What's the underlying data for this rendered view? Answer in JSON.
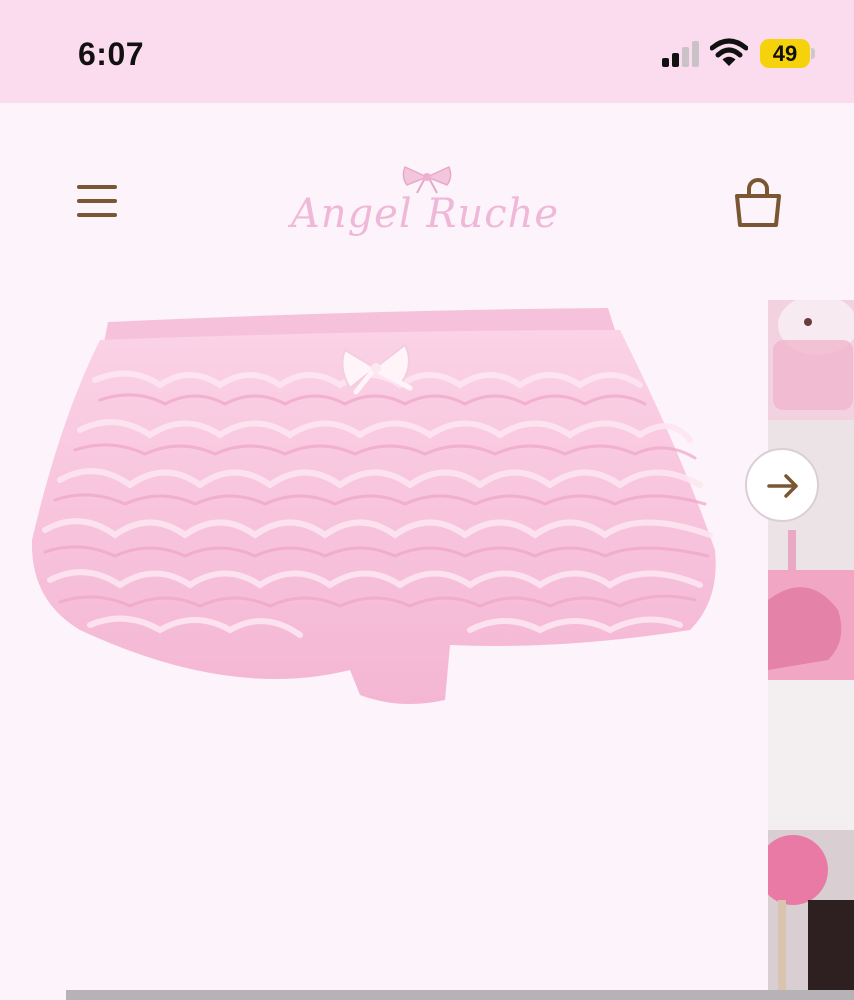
{
  "status_bar": {
    "time": "6:07",
    "battery_level": "49",
    "icons": [
      "signal-icon",
      "wifi-icon",
      "battery-icon"
    ]
  },
  "header": {
    "brand_name": "Angel Ruche",
    "icons": [
      "menu-icon",
      "bow-icon",
      "shopping-bag-icon"
    ]
  },
  "gallery": {
    "next_icon": "arrow-right-icon"
  },
  "colors": {
    "status_bg": "#fbdcef",
    "page_bg": "#fdf3fa",
    "brand_pink": "#f0b8d8",
    "icon_brown": "#7b5632",
    "battery_yellow": "#f5d20c",
    "product_pink": "#f7bdd8"
  }
}
